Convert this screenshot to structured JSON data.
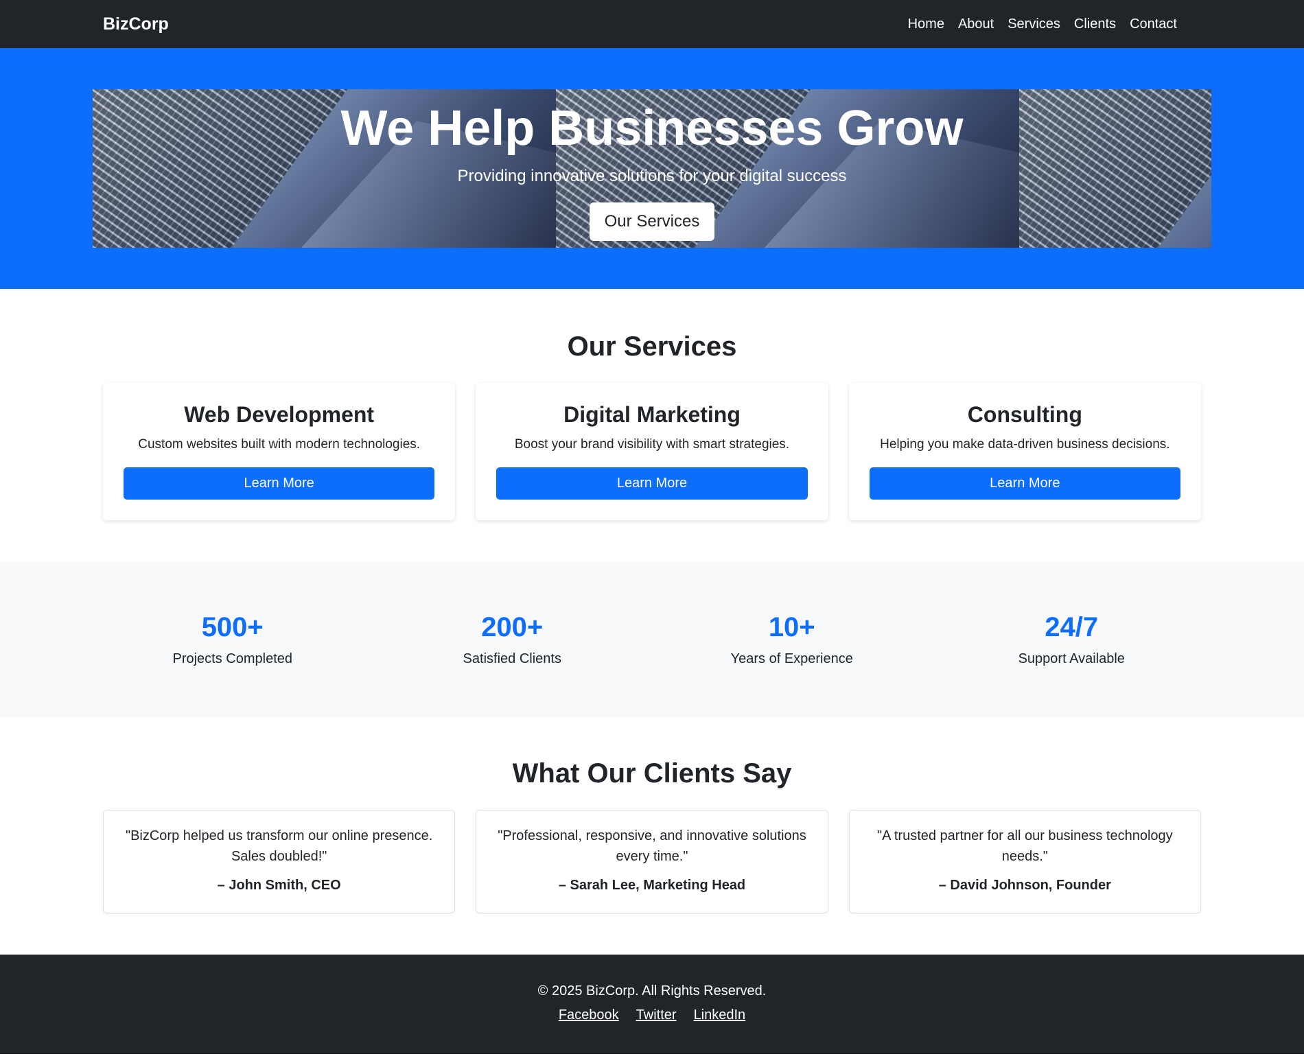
{
  "nav": {
    "brand": "BizCorp",
    "links": [
      "Home",
      "About",
      "Services",
      "Clients",
      "Contact"
    ]
  },
  "hero": {
    "title": "We Help Businesses Grow",
    "subtitle": "Providing innovative solutions for your digital success",
    "button": "Our Services"
  },
  "services": {
    "title": "Our Services",
    "items": [
      {
        "title": "Web Development",
        "text": "Custom websites built with modern technologies.",
        "button": "Learn More"
      },
      {
        "title": "Digital Marketing",
        "text": "Boost your brand visibility with smart strategies.",
        "button": "Learn More"
      },
      {
        "title": "Consulting",
        "text": "Helping you make data-driven business decisions.",
        "button": "Learn More"
      }
    ]
  },
  "stats": [
    {
      "value": "500+",
      "label": "Projects Completed"
    },
    {
      "value": "200+",
      "label": "Satisfied Clients"
    },
    {
      "value": "10+",
      "label": "Years of Experience"
    },
    {
      "value": "24/7",
      "label": "Support Available"
    }
  ],
  "testimonials": {
    "title": "What Our Clients Say",
    "items": [
      {
        "quote": "\"BizCorp helped us transform our online presence. Sales doubled!\"",
        "author": "– John Smith, CEO"
      },
      {
        "quote": "\"Professional, responsive, and innovative solutions every time.\"",
        "author": "– Sarah Lee, Marketing Head"
      },
      {
        "quote": "\"A trusted partner for all our business technology needs.\"",
        "author": "– David Johnson, Founder"
      }
    ]
  },
  "footer": {
    "copyright": "© 2025 BizCorp. All Rights Reserved.",
    "links": [
      "Facebook",
      "Twitter",
      "LinkedIn"
    ]
  },
  "colors": {
    "primary": "#0d6efd",
    "dark": "#212529",
    "light": "#f8f9fa"
  }
}
